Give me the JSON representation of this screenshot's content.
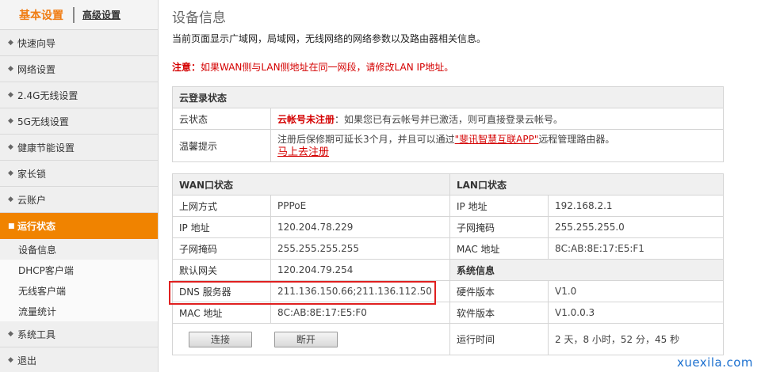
{
  "sidebar": {
    "tab_basic": "基本设置",
    "tab_advanced": "高级设置",
    "items": [
      {
        "label": "快速向导"
      },
      {
        "label": "网络设置"
      },
      {
        "label": "2.4G无线设置"
      },
      {
        "label": "5G无线设置"
      },
      {
        "label": "健康节能设置"
      },
      {
        "label": "家长锁"
      },
      {
        "label": "云账户"
      },
      {
        "label": "运行状态"
      }
    ],
    "sub_items": [
      {
        "label": "设备信息"
      },
      {
        "label": "DHCP客户端"
      },
      {
        "label": "无线客户端"
      },
      {
        "label": "流量统计"
      }
    ],
    "bottom_items": [
      {
        "label": "系统工具"
      },
      {
        "label": "退出"
      }
    ]
  },
  "main": {
    "title": "设备信息",
    "description": "当前页面显示广域网，局域网，无线网络的网络参数以及路由器相关信息。",
    "notice_prefix": "注意：",
    "notice_text": "如果WAN侧与LAN侧地址在同一网段，请修改LAN IP地址。"
  },
  "cloud": {
    "header": "云登录状态",
    "status_label": "云状态",
    "status_red": "云帐号未注册",
    "status_text": "：如果您已有云帐号并已激活，则可直接登录云帐号。",
    "tip_label": "温馨提示",
    "tip_text_1": "注册后保修期可延长3个月，并且可以通过",
    "tip_app": "\"斐讯智慧互联APP\"",
    "tip_text_2": "远程管理路由器。",
    "register_link": "马上去注册"
  },
  "wan": {
    "header": "WAN口状态",
    "rows": [
      {
        "label": "上网方式",
        "value": "PPPoE"
      },
      {
        "label": "IP 地址",
        "value": "120.204.78.229"
      },
      {
        "label": "子网掩码",
        "value": "255.255.255.255"
      },
      {
        "label": "默认网关",
        "value": "120.204.79.254"
      },
      {
        "label": "DNS 服务器",
        "value": "211.136.150.66;211.136.112.50"
      },
      {
        "label": "MAC 地址",
        "value": "8C:AB:8E:17:E5:F0"
      }
    ],
    "connect_button": "连接",
    "disconnect_button": "断开"
  },
  "lan": {
    "header": "LAN口状态",
    "rows": [
      {
        "label": "IP 地址",
        "value": "192.168.2.1"
      },
      {
        "label": "子网掩码",
        "value": "255.255.255.0"
      },
      {
        "label": "MAC 地址",
        "value": "8C:AB:8E:17:E5:F1"
      }
    ]
  },
  "system": {
    "header": "系统信息",
    "rows": [
      {
        "label": "硬件版本",
        "value": "V1.0"
      },
      {
        "label": "软件版本",
        "value": "V1.0.0.3"
      },
      {
        "label": "运行时间",
        "value": "2 天，8 小时，52 分，45 秒"
      }
    ]
  },
  "watermark": "xuexila.com",
  "colors": {
    "accent": "#f08300",
    "warning": "#d40000",
    "highlight": "#e02020"
  }
}
